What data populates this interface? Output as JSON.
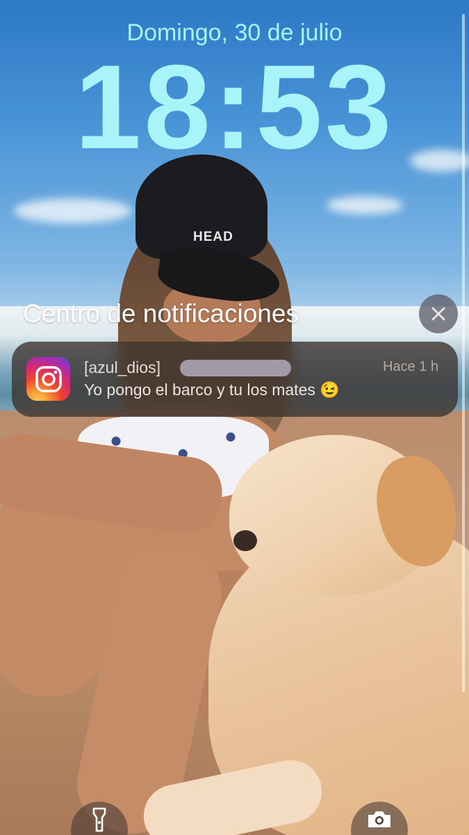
{
  "lockscreen": {
    "date": "Domingo, 30 de julio",
    "time": "18:53"
  },
  "notification_center": {
    "title": "Centro de notificaciones",
    "close_icon": "close-icon"
  },
  "notifications": [
    {
      "app": "Instagram",
      "app_icon": "instagram-icon",
      "sender": "[azul_dios]",
      "time": "Hace 1 h",
      "body": "Yo pongo el barco y tu los mates 😉"
    }
  ],
  "quick_actions": {
    "left_icon": "flashlight-icon",
    "right_icon": "camera-icon"
  },
  "colors": {
    "clock": "#a8f4f8",
    "notification_bg": "#3c322d",
    "close_button_bg": "#5f5f69",
    "instagram_gradient": [
      "#fdd05b",
      "#f0402e",
      "#d62976",
      "#962fbf",
      "#4f5bd5"
    ]
  }
}
